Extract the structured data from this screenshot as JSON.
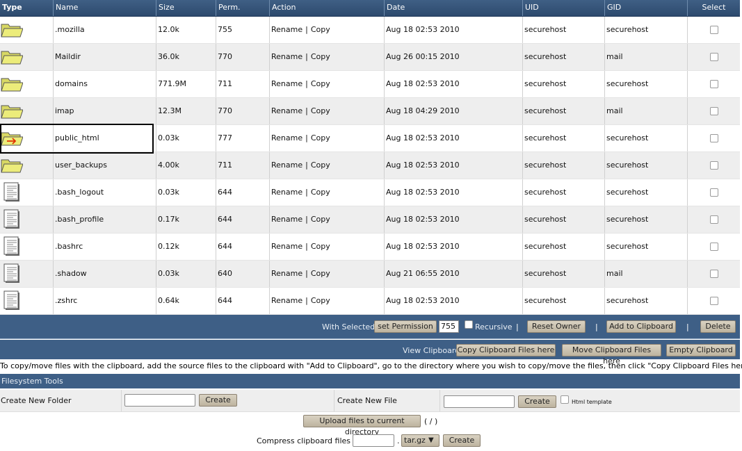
{
  "columns": {
    "type": "Type",
    "name": "Name",
    "size": "Size",
    "perm": "Perm.",
    "action": "Action",
    "date": "Date",
    "uid": "UID",
    "gid": "GID",
    "select": "Select"
  },
  "files": [
    {
      "icon": "folder-icon",
      "name": ".mozilla",
      "size": "12.0k",
      "perm": "755",
      "rename": "Rename",
      "copy": "Copy",
      "date": "Aug 18 02:53 2010",
      "uid": "securehost",
      "gid": "securehost"
    },
    {
      "icon": "folder-icon",
      "name": "Maildir",
      "size": "36.0k",
      "perm": "770",
      "rename": "Rename",
      "copy": "Copy",
      "date": "Aug 26 00:15 2010",
      "uid": "securehost",
      "gid": "mail"
    },
    {
      "icon": "folder-icon",
      "name": "domains",
      "size": "771.9M",
      "perm": "711",
      "rename": "Rename",
      "copy": "Copy",
      "date": "Aug 18 02:53 2010",
      "uid": "securehost",
      "gid": "securehost"
    },
    {
      "icon": "folder-icon",
      "name": "imap",
      "size": "12.3M",
      "perm": "770",
      "rename": "Rename",
      "copy": "Copy",
      "date": "Aug 18 04:29 2010",
      "uid": "securehost",
      "gid": "mail"
    },
    {
      "icon": "folder-link-icon",
      "name": "public_html",
      "size": "0.03k",
      "perm": "777",
      "rename": "Rename",
      "copy": "Copy",
      "date": "Aug 18 02:53 2010",
      "uid": "securehost",
      "gid": "securehost"
    },
    {
      "icon": "folder-icon",
      "name": "user_backups",
      "size": "4.00k",
      "perm": "711",
      "rename": "Rename",
      "copy": "Copy",
      "date": "Aug 18 02:53 2010",
      "uid": "securehost",
      "gid": "securehost"
    },
    {
      "icon": "file-icon",
      "name": ".bash_logout",
      "size": "0.03k",
      "perm": "644",
      "rename": "Rename",
      "copy": "Copy",
      "date": "Aug 18 02:53 2010",
      "uid": "securehost",
      "gid": "securehost"
    },
    {
      "icon": "file-icon",
      "name": ".bash_profile",
      "size": "0.17k",
      "perm": "644",
      "rename": "Rename",
      "copy": "Copy",
      "date": "Aug 18 02:53 2010",
      "uid": "securehost",
      "gid": "securehost"
    },
    {
      "icon": "file-icon",
      "name": ".bashrc",
      "size": "0.12k",
      "perm": "644",
      "rename": "Rename",
      "copy": "Copy",
      "date": "Aug 18 02:53 2010",
      "uid": "securehost",
      "gid": "securehost"
    },
    {
      "icon": "file-icon",
      "name": ".shadow",
      "size": "0.03k",
      "perm": "640",
      "rename": "Rename",
      "copy": "Copy",
      "date": "Aug 21 06:55 2010",
      "uid": "securehost",
      "gid": "mail"
    },
    {
      "icon": "file-icon",
      "name": ".zshrc",
      "size": "0.64k",
      "perm": "644",
      "rename": "Rename",
      "copy": "Copy",
      "date": "Aug 18 02:53 2010",
      "uid": "securehost",
      "gid": "securehost"
    }
  ],
  "action_separator": "|",
  "bulk": {
    "with_selected": "With Selected",
    "set_permission": "set Permission",
    "perm_value": "755",
    "recursive": "Recursive",
    "separator": "|",
    "reset_owner": "Reset Owner",
    "add_to_clipboard": "Add to Clipboard",
    "delete": "Delete"
  },
  "clipboard": {
    "view": "View Clipboard",
    "copy_here": "Copy Clipboard Files here",
    "move_here": "Move Clipboard Files here",
    "empty": "Empty Clipboard"
  },
  "info_text": "To copy/move files with the clipboard, add the source files to the clipboard with \"Add to Clipboard\", go to the directory where you wish to copy/move the files, then click \"Copy Clipboard Files here\" or \"Move Clipboard Files here\"",
  "tools": {
    "title": "Filesystem Tools",
    "create_folder_label": "Create New Folder",
    "create_folder_button": "Create",
    "create_file_label": "Create New File",
    "create_file_button": "Create",
    "html_template": "Html template",
    "upload_button": "Upload files to current directory",
    "upload_path": "( / )",
    "compress_label": "Compress clipboard files to //",
    "compress_dot": ".",
    "compress_ext": "tar.gz",
    "compress_button": "Create"
  },
  "colors": {
    "header": "#2d4a6e",
    "bar": "#3e5f86",
    "button": "#c9c0ad",
    "folder": "#ecec7a",
    "link_arrow": "#e03000"
  }
}
